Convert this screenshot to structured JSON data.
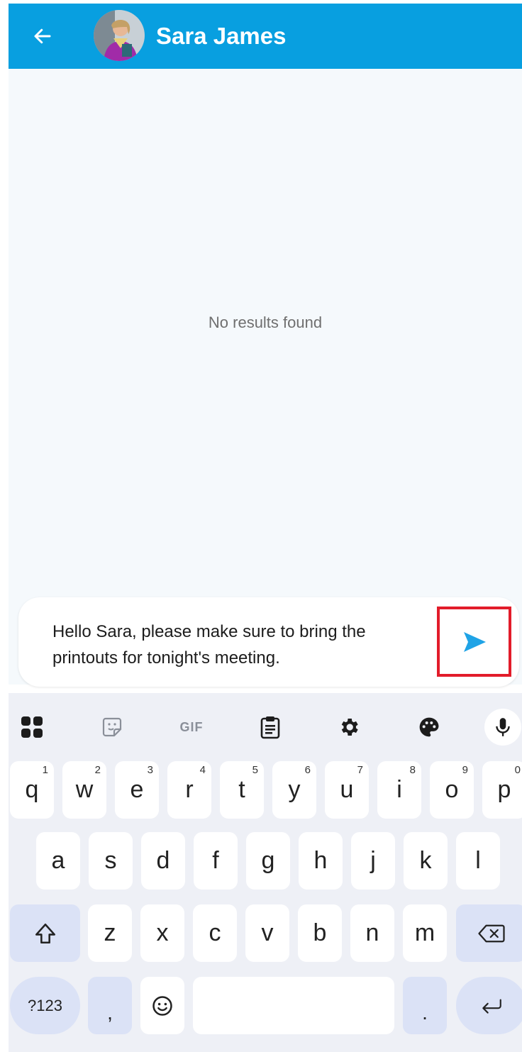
{
  "header": {
    "contact_name": "Sara James",
    "back_icon": "arrow-left-icon",
    "avatar_icon": "avatar-photo"
  },
  "content": {
    "empty_text": "No results found"
  },
  "composer": {
    "message": "Hello Sara, please make sure to bring the printouts for tonight's meeting.",
    "send_icon": "send-icon"
  },
  "keyboard": {
    "toolbar": {
      "apps_icon": "apps-grid-icon",
      "sticker_icon": "sticker-icon",
      "gif_label": "GIF",
      "clipboard_icon": "clipboard-icon",
      "settings_icon": "gear-icon",
      "theme_icon": "palette-icon",
      "mic_icon": "microphone-icon"
    },
    "row1": [
      {
        "key": "q",
        "hint": "1"
      },
      {
        "key": "w",
        "hint": "2"
      },
      {
        "key": "e",
        "hint": "3"
      },
      {
        "key": "r",
        "hint": "4"
      },
      {
        "key": "t",
        "hint": "5"
      },
      {
        "key": "y",
        "hint": "6"
      },
      {
        "key": "u",
        "hint": "7"
      },
      {
        "key": "i",
        "hint": "8"
      },
      {
        "key": "o",
        "hint": "9"
      },
      {
        "key": "p",
        "hint": "0"
      }
    ],
    "row2": [
      "a",
      "s",
      "d",
      "f",
      "g",
      "h",
      "j",
      "k",
      "l"
    ],
    "row3": [
      "z",
      "x",
      "c",
      "v",
      "b",
      "n",
      "m"
    ],
    "shift_icon": "shift-icon",
    "backspace_icon": "backspace-icon",
    "symbols_label": "?123",
    "comma_label": ",",
    "emoji_icon": "emoji-icon",
    "period_label": ".",
    "enter_icon": "enter-icon"
  },
  "colors": {
    "header_bg": "#089fe0",
    "accent": "#1fa3e6",
    "highlight_box": "#e21c2a",
    "keyboard_bg": "#eef0f6",
    "special_key_bg": "#dbe2f6"
  }
}
